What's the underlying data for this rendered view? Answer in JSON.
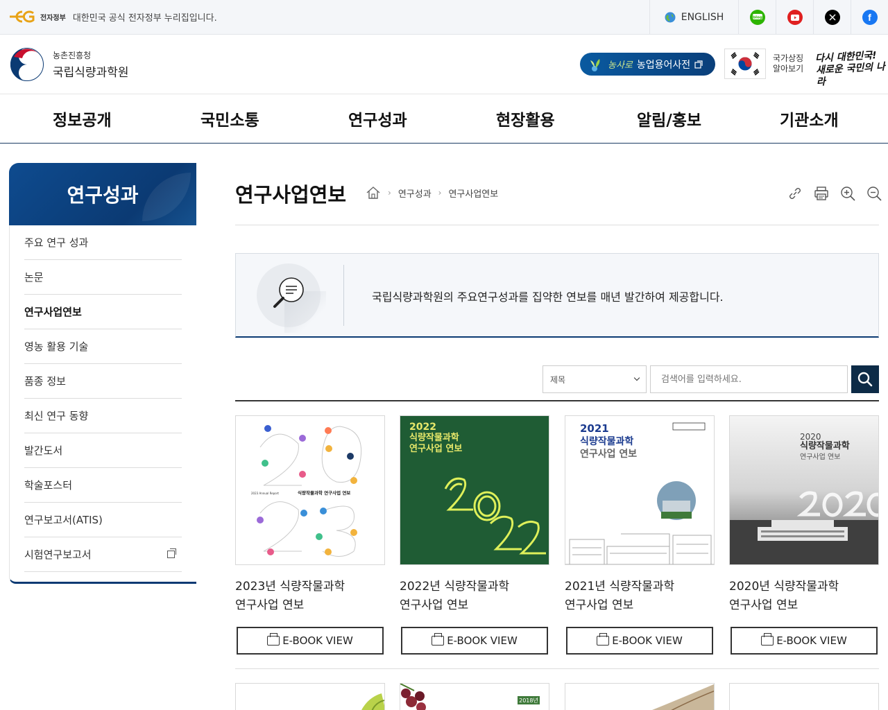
{
  "govbar": {
    "brand": "전자정부",
    "official_notice": "대한민국 공식 전자정부 누리집입니다.",
    "english_label": "ENGLISH",
    "sns": [
      {
        "name": "blog",
        "label": "blog",
        "color": "#2db400"
      },
      {
        "name": "youtube",
        "label": "▶",
        "color": "#e02020"
      },
      {
        "name": "x",
        "label": "X",
        "color": "#000000"
      },
      {
        "name": "facebook",
        "label": "f",
        "color": "#1877f2"
      }
    ]
  },
  "header": {
    "org_top": "농촌진흥청",
    "org_name": "국립식량과학원",
    "dict_brand": "농사로",
    "dict_label": "농업용어사전",
    "symbols_line1": "국가상징",
    "symbols_line2": "알아보기",
    "slogan_line1": "다시 대한민국!",
    "slogan_line2": "새로운 국민의 나라"
  },
  "gnb": [
    "정보공개",
    "국민소통",
    "연구성과",
    "현장활용",
    "알림/홍보",
    "기관소개"
  ],
  "sidebar": {
    "title": "연구성과",
    "items": [
      {
        "label": "주요 연구 성과",
        "active": false,
        "external": false
      },
      {
        "label": "논문",
        "active": false,
        "external": false
      },
      {
        "label": "연구사업연보",
        "active": true,
        "external": false
      },
      {
        "label": "영농 활용 기술",
        "active": false,
        "external": false
      },
      {
        "label": "품종 정보",
        "active": false,
        "external": false
      },
      {
        "label": "최신 연구 동향",
        "active": false,
        "external": false
      },
      {
        "label": "발간도서",
        "active": false,
        "external": false
      },
      {
        "label": "학술포스터",
        "active": false,
        "external": false
      },
      {
        "label": "연구보고서(ATIS)",
        "active": false,
        "external": false
      },
      {
        "label": "시험연구보고서",
        "active": false,
        "external": true
      }
    ]
  },
  "page": {
    "title": "연구사업연보",
    "breadcrumb": [
      "연구성과",
      "연구사업연보"
    ],
    "intro": "국립식량과학원의 주요연구성과를 집약한 연보를 매년 발간하여 제공합니다."
  },
  "search": {
    "field_selected": "제목",
    "placeholder": "검색어를 입력하세요."
  },
  "books": [
    {
      "title_line1": "2023년 식량작물과학",
      "title_line2": "연구사업 연보",
      "button": "E-BOOK VIEW",
      "cover_caption": "식량작물과학 연구사업 연보"
    },
    {
      "title_line1": "2022년 식량작물과학",
      "title_line2": "연구사업 연보",
      "button": "E-BOOK VIEW",
      "cover_year": "2022",
      "cover_l1": "식량작물과학",
      "cover_l2": "연구사업 연보"
    },
    {
      "title_line1": "2021년 식량작물과학",
      "title_line2": "연구사업 연보",
      "button": "E-BOOK VIEW",
      "cover_year": "2021",
      "cover_l1": "식량작물과학",
      "cover_l2": "연구사업 연보"
    },
    {
      "title_line1": "2020년 식량작물과학",
      "title_line2": "연구사업 연보",
      "button": "E-BOOK VIEW",
      "cover_year": "2020",
      "cover_l1": "식량작물과학",
      "cover_l2": "연구사업 연보"
    }
  ],
  "next_row": {
    "badge_2018": "2018년"
  }
}
